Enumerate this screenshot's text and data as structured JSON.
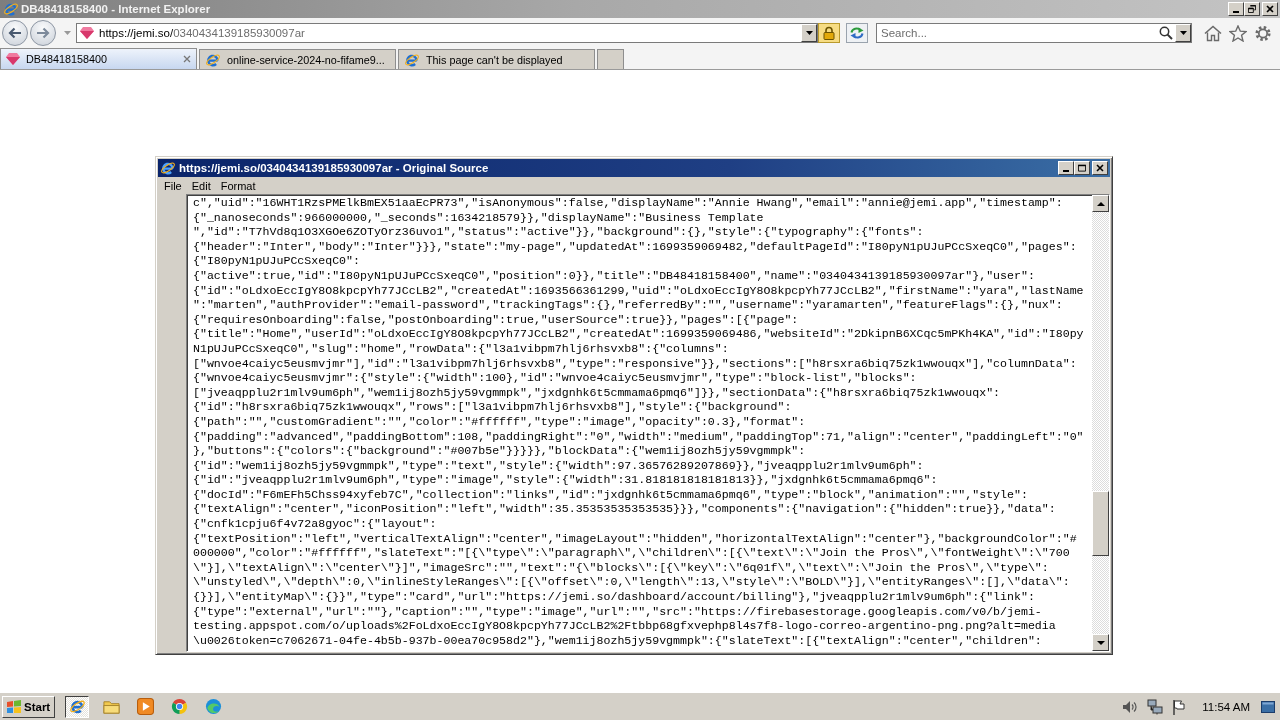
{
  "window": {
    "title": "DB48418158400 - Internet Explorer"
  },
  "address_bar": {
    "url_domain": "https://jemi.so/",
    "url_path": "0340434139185930097ar"
  },
  "search": {
    "placeholder": "Search..."
  },
  "tabs": [
    {
      "label": "DB48418158400",
      "selected": true,
      "kind": "site"
    },
    {
      "label": "online-service-2024-no-fifame9...",
      "selected": false,
      "kind": "page"
    },
    {
      "label": "This page can't be displayed",
      "selected": false,
      "kind": "page"
    }
  ],
  "source_window": {
    "title": "https://jemi.so/0340434139185930097ar - Original Source",
    "menu": [
      "File",
      "Edit",
      "Format"
    ],
    "lines": [
      "c\",\"uid\":\"16WHT1RzsPMElkBmEX51aaEcPR73\",\"isAnonymous\":false,\"displayName\":\"Annie Hwang\",\"email\":\"annie@jemi.app\",\"timestamp\":",
      "{\"_nanoseconds\":966000000,\"_seconds\":1634218579}},\"displayName\":\"Business Template",
      "\",\"id\":\"T7hVd8q1O3XGOe6ZOTyOrz36uvo1\",\"status\":\"active\"}},\"background\":{},\"style\":{\"typography\":{\"fonts\":",
      "{\"header\":\"Inter\",\"body\":\"Inter\"}}},\"state\":\"my-page\",\"updatedAt\":1699359069482,\"defaultPageId\":\"I80pyN1pUJuPCcSxeqC0\",\"pages\":",
      "{\"I80pyN1pUJuPCcSxeqC0\":",
      "{\"active\":true,\"id\":\"I80pyN1pUJuPCcSxeqC0\",\"position\":0}},\"title\":\"DB48418158400\",\"name\":\"0340434139185930097ar\"},\"user\":",
      "{\"id\":\"oLdxoEccIgY8O8kpcpYh77JCcLB2\",\"createdAt\":1693566361299,\"uid\":\"oLdxoEccIgY8O8kpcpYh77JCcLB2\",\"firstName\":\"yara\",\"lastName",
      "\":\"marten\",\"authProvider\":\"email-password\",\"trackingTags\":{},\"referredBy\":\"\",\"username\":\"yaramarten\",\"featureFlags\":{},\"nux\":",
      "{\"requiresOnboarding\":false,\"postOnboarding\":true,\"userSource\":true}},\"pages\":[{\"page\":",
      "{\"title\":\"Home\",\"userId\":\"oLdxoEccIgY8O8kpcpYh77JCcLB2\",\"createdAt\":1699359069486,\"websiteId\":\"2DkipnB6XCqc5mPKh4KA\",\"id\":\"I80py",
      "N1pUJuPCcSxeqC0\",\"slug\":\"home\",\"rowData\":{\"l3a1vibpm7hlj6rhsvxb8\":{\"columns\":",
      "[\"wnvoe4caiyc5eusmvjmr\"],\"id\":\"l3a1vibpm7hlj6rhsvxb8\",\"type\":\"responsive\"}},\"sections\":[\"h8rsxra6biq75zk1wwouqx\"],\"columnData\":",
      "{\"wnvoe4caiyc5eusmvjmr\":{\"style\":{\"width\":100},\"id\":\"wnvoe4caiyc5eusmvjmr\",\"type\":\"block-list\",\"blocks\":",
      "[\"jveaqpplu2r1mlv9um6ph\",\"wem1ij8ozh5jy59vgmmpk\",\"jxdgnhk6t5cmmama6pmq6\"]}},\"sectionData\":{\"h8rsxra6biq75zk1wwouqx\":",
      "{\"id\":\"h8rsxra6biq75zk1wwouqx\",\"rows\":[\"l3a1vibpm7hlj6rhsvxb8\"],\"style\":{\"background\":",
      "{\"path\":\"\",\"customGradient\":\"\",\"color\":\"#ffffff\",\"type\":\"image\",\"opacity\":0.3},\"format\":",
      "{\"padding\":\"advanced\",\"paddingBottom\":108,\"paddingRight\":\"0\",\"width\":\"medium\",\"paddingTop\":71,\"align\":\"center\",\"paddingLeft\":\"0\"",
      "},\"buttons\":{\"colors\":{\"background\":\"#007b5e\"}}}}},\"blockData\":{\"wem1ij8ozh5jy59vgmmpk\":",
      "{\"id\":\"wem1ij8ozh5jy59vgmmpk\",\"type\":\"text\",\"style\":{\"width\":97.36576289207869}},\"jveaqpplu2r1mlv9um6ph\":",
      "{\"id\":\"jveaqpplu2r1mlv9um6ph\",\"type\":\"image\",\"style\":{\"width\":31.818181818181813}},\"jxdgnhk6t5cmmama6pmq6\":",
      "{\"docId\":\"F6mEFh5Chss94xyfeb7C\",\"collection\":\"links\",\"id\":\"jxdgnhk6t5cmmama6pmq6\",\"type\":\"block\",\"animation\":\"\",\"style\":",
      "{\"textAlign\":\"center\",\"iconPosition\":\"left\",\"width\":35.35353535353535}}},\"components\":{\"navigation\":{\"hidden\":true}},\"data\":",
      "{\"cnfk1cpju6f4v72a8gyoc\":{\"layout\":",
      "{\"textPosition\":\"left\",\"verticalTextAlign\":\"center\",\"imageLayout\":\"hidden\",\"horizontalTextAlign\":\"center\"},\"backgroundColor\":\"#",
      "000000\",\"color\":\"#ffffff\",\"slateText\":\"[{\\\"type\\\":\\\"paragraph\\\",\\\"children\\\":[{\\\"text\\\":\\\"Join the Pros\\\",\\\"fontWeight\\\":\\\"700",
      "\\\"}],\\\"textAlign\\\":\\\"center\\\"}]\",\"imageSrc\":\"\",\"text\":\"{\\\"blocks\\\":[{\\\"key\\\":\\\"6q01f\\\",\\\"text\\\":\\\"Join the Pros\\\",\\\"type\\\":",
      "\\\"unstyled\\\",\\\"depth\\\":0,\\\"inlineStyleRanges\\\":[{\\\"offset\\\":0,\\\"length\\\":13,\\\"style\\\":\\\"BOLD\\\"}],\\\"entityRanges\\\":[],\\\"data\\\":",
      "{}}],\\\"entityMap\\\":{}}\",\"type\":\"card\",\"url\":\"https://jemi.so/dashboard/account/billing\"},\"jveaqpplu2r1mlv9um6ph\":{\"link\":",
      "{\"type\":\"external\",\"url\":\"\"},\"caption\":\"\",\"type\":\"image\",\"url\":\"\",\"src\":\"https://firebasestorage.googleapis.com/v0/b/jemi-",
      "testing.appspot.com/o/uploads%2FoLdxoEccIgY8O8kpcpYh77JCcLB2%2Ftbbp68gfxvephp8l4s7f8-logo-correo-argentino-png.png?alt=media",
      "\\u0026token=c7062671-04fe-4b5b-937b-00ea70c958d2\"},\"wem1ij8ozh5jy59vgmmpk\":{\"slateText\":[{\"textAlign\":\"center\",\"children\":"
    ]
  },
  "taskbar": {
    "start": "Start",
    "apps": [
      {
        "selected": true
      },
      {
        "selected": false
      },
      {
        "selected": false
      },
      {
        "selected": false
      },
      {
        "selected": false
      }
    ],
    "clock": "11:54 AM"
  }
}
